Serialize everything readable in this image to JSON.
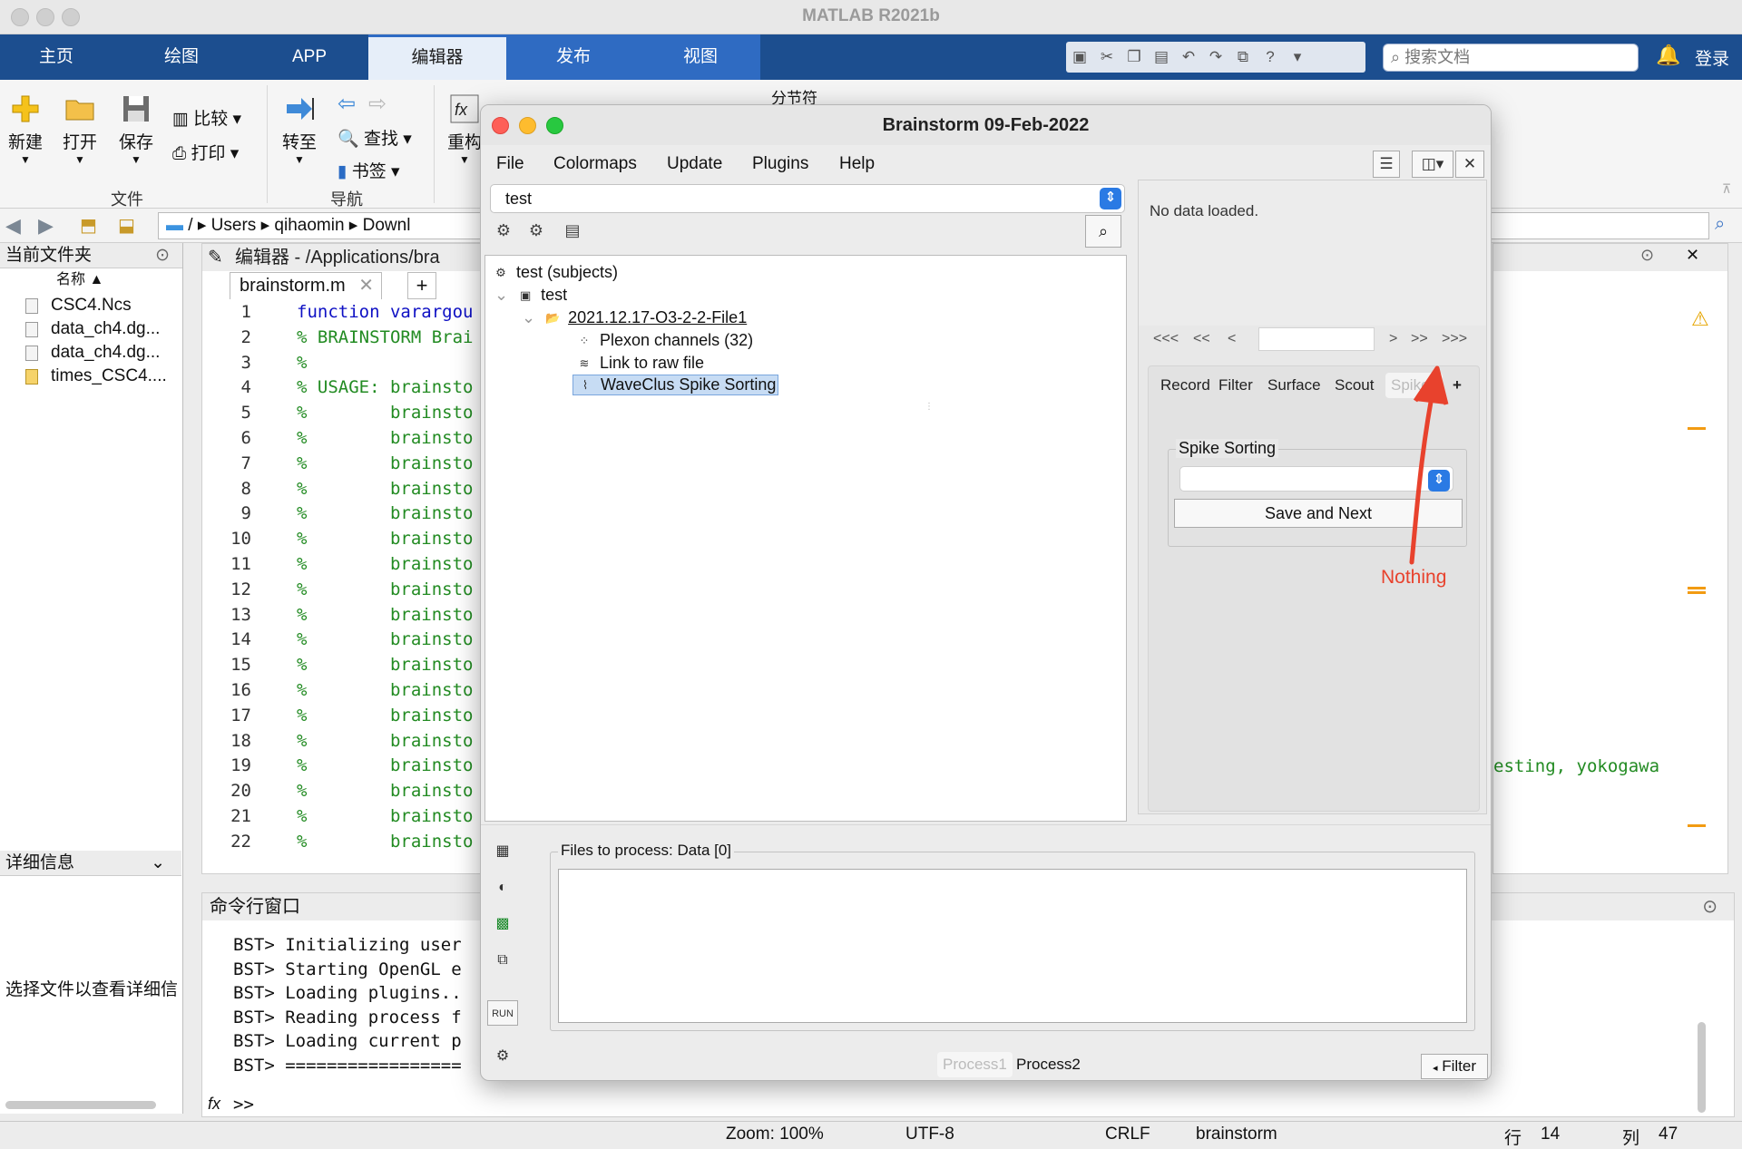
{
  "matlab": {
    "window_title": "MATLAB R2021b",
    "tabs": [
      "主页",
      "绘图",
      "APP",
      "编辑器",
      "发布",
      "视图"
    ],
    "active_tab": "编辑器",
    "search_placeholder": "搜索文档",
    "login": "登录",
    "ribbon": {
      "new": "新建",
      "open": "打开",
      "save": "保存",
      "compare": "比较",
      "print": "打印",
      "goto": "转至",
      "find": "查找",
      "bookmark": "书签",
      "refactor": "重构",
      "section_break": "分节符",
      "group_file": "文件",
      "group_nav": "导航"
    },
    "address_path": [
      "/",
      "Users",
      "qihaomin",
      "Downl"
    ],
    "current_folder_title": "当前文件夹",
    "name_column": "名称 ▲",
    "files": [
      "CSC4.Ncs",
      "data_ch4.dg...",
      "data_ch4.dg...",
      "times_CSC4...."
    ],
    "details_title": "详细信息",
    "details_hint": "选择文件以查看详细信",
    "editor_title": "编辑器 - /Applications/bra",
    "editor_tab": "brainstorm.m",
    "code_lines": [
      {
        "n": "1",
        "t": "function varargou",
        "kw": true
      },
      {
        "n": "2",
        "t": "% BRAINSTORM Brai"
      },
      {
        "n": "3",
        "t": "%"
      },
      {
        "n": "4",
        "t": "% USAGE: brainsto"
      },
      {
        "n": "5",
        "t": "%        brainsto"
      },
      {
        "n": "6",
        "t": "%        brainsto"
      },
      {
        "n": "7",
        "t": "%        brainsto"
      },
      {
        "n": "8",
        "t": "%        brainsto"
      },
      {
        "n": "9",
        "t": "%        brainsto"
      },
      {
        "n": "10",
        "t": "%        brainsto"
      },
      {
        "n": "11",
        "t": "%        brainsto"
      },
      {
        "n": "12",
        "t": "%        brainsto"
      },
      {
        "n": "13",
        "t": "%        brainsto"
      },
      {
        "n": "14",
        "t": "%        brainsto"
      },
      {
        "n": "15",
        "t": "%        brainsto"
      },
      {
        "n": "16",
        "t": "%        brainsto"
      },
      {
        "n": "17",
        "t": "%        brainsto"
      },
      {
        "n": "18",
        "t": "%        brainsto"
      },
      {
        "n": "19",
        "t": "%        brainsto"
      },
      {
        "n": "20",
        "t": "%        brainsto"
      },
      {
        "n": "21",
        "t": "%        brainsto"
      },
      {
        "n": "22",
        "t": "%        brainsto"
      }
    ],
    "right_code_fragment": "esting, yokogawa",
    "command_window_title": "命令行窗口",
    "command_lines": [
      "BST> Initializing user",
      "BST> Starting OpenGL e",
      "BST> Loading plugins..",
      "BST> Reading process f",
      "BST> Loading current p",
      "BST> ================="
    ],
    "prompt": ">>",
    "status": {
      "zoom": "Zoom: 100%",
      "encoding": "UTF-8",
      "eol": "CRLF",
      "file": "brainstorm",
      "row_label": "行",
      "row": "14",
      "col_label": "列",
      "col": "47"
    }
  },
  "brainstorm": {
    "title": "Brainstorm 09-Feb-2022",
    "menu": [
      "File",
      "Colormaps",
      "Update",
      "Plugins",
      "Help"
    ],
    "protocol": "test",
    "tree": {
      "root": "test (subjects)",
      "subject": "test",
      "raw_folder": "2021.12.17-O3-2-2-File1",
      "items": [
        "Plexon channels (32)",
        "Link to raw file",
        "WaveClus Spike Sorting"
      ],
      "selected": "WaveClus Spike Sorting"
    },
    "no_data": "No data loaded.",
    "nav_buttons": [
      "<<<",
      "<<",
      "<",
      ">",
      ">>",
      ">>>"
    ],
    "right_tabs": [
      "Record",
      "Filter",
      "Surface",
      "Scout",
      "Spikes",
      "+"
    ],
    "active_right_tab": "Spikes",
    "spike_sorting_title": "Spike Sorting",
    "save_next": "Save and Next",
    "files_to_process": "Files to process: Data [0]",
    "process_tabs": [
      "Process1",
      "Process2"
    ],
    "filter_button": "Filter",
    "run_label": "RUN",
    "annotation": "Nothing",
    "annotation_color": "#e8422d",
    "accent_blue": "#2a7ae4",
    "ribbon_blue": "#1c4e8f"
  }
}
